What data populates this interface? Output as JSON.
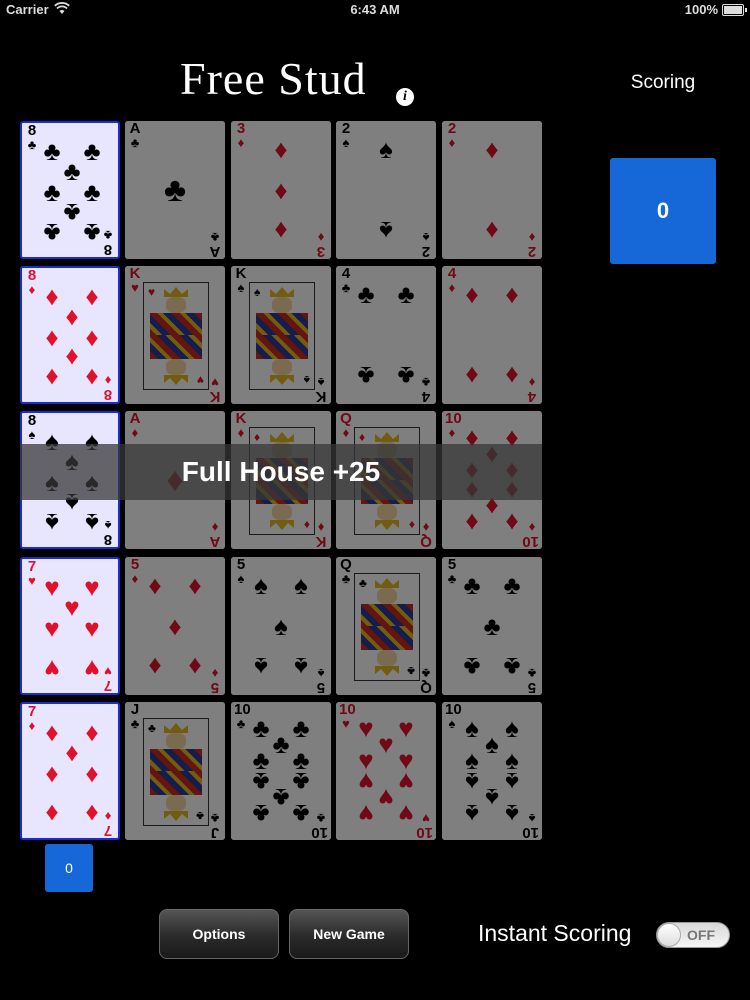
{
  "status_bar": {
    "carrier": "Carrier",
    "time": "6:43 AM",
    "battery": "100%"
  },
  "title": "Free Stud",
  "info_icon": "i",
  "scoring": {
    "label": "Scoring",
    "value": "0"
  },
  "colors": {
    "red_suit": "#e0112b",
    "black_suit": "#000000",
    "score_blue": "#1668d8",
    "selected_border": "#1c2cd0"
  },
  "suits": {
    "clubs": "♣",
    "diamonds": "♦",
    "spades": "♠",
    "hearts": "♥"
  },
  "grid": [
    [
      {
        "rank": "8",
        "suit": "clubs",
        "selected": true
      },
      {
        "rank": "A",
        "suit": "clubs"
      },
      {
        "rank": "3",
        "suit": "diamonds"
      },
      {
        "rank": "2",
        "suit": "spades"
      },
      {
        "rank": "2",
        "suit": "diamonds"
      }
    ],
    [
      {
        "rank": "8",
        "suit": "diamonds",
        "selected": true
      },
      {
        "rank": "K",
        "suit": "hearts"
      },
      {
        "rank": "K",
        "suit": "spades"
      },
      {
        "rank": "4",
        "suit": "clubs"
      },
      {
        "rank": "4",
        "suit": "diamonds"
      }
    ],
    [
      {
        "rank": "8",
        "suit": "spades",
        "selected": true
      },
      {
        "rank": "A",
        "suit": "diamonds"
      },
      {
        "rank": "K",
        "suit": "diamonds"
      },
      {
        "rank": "Q",
        "suit": "diamonds"
      },
      {
        "rank": "10",
        "suit": "diamonds"
      }
    ],
    [
      {
        "rank": "7",
        "suit": "hearts",
        "selected": true
      },
      {
        "rank": "5",
        "suit": "diamonds"
      },
      {
        "rank": "5",
        "suit": "spades"
      },
      {
        "rank": "Q",
        "suit": "clubs"
      },
      {
        "rank": "5",
        "suit": "clubs"
      }
    ],
    [
      {
        "rank": "7",
        "suit": "diamonds",
        "selected": true
      },
      {
        "rank": "J",
        "suit": "clubs"
      },
      {
        "rank": "10",
        "suit": "clubs"
      },
      {
        "rank": "10",
        "suit": "hearts"
      },
      {
        "rank": "10",
        "suit": "spades"
      }
    ]
  ],
  "hand_result": "Full House +25",
  "column_score": "0",
  "buttons": {
    "options": "Options",
    "new_game": "New Game"
  },
  "instant_scoring": {
    "label": "Instant Scoring",
    "state": "OFF"
  }
}
